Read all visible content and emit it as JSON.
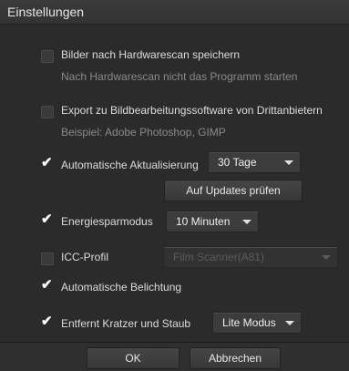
{
  "window": {
    "title": "Einstellungen"
  },
  "settings": {
    "save_hw": {
      "label": "Bilder nach Hardwarescan speichern",
      "checked": false
    },
    "save_hw_hint": "Nach Hardwarescan nicht das Programm starten",
    "export": {
      "label": "Export zu Bildbearbeitungssoftware von Drittanbietern",
      "checked": false
    },
    "export_hint": "Beispiel: Adobe Photoshop, GIMP",
    "auto_update": {
      "label": "Automatische Aktualisierung",
      "checked": true,
      "interval": "30 Tage"
    },
    "check_updates_label": "Auf Updates prüfen",
    "energy": {
      "label": "Energiesparmodus",
      "checked": true,
      "value": "10 Minuten"
    },
    "icc": {
      "label": "ICC-Profil",
      "checked": false,
      "value": "Film Scanner(A81)"
    },
    "auto_exposure": {
      "label": "Automatische Belichtung",
      "checked": true
    },
    "dust": {
      "label": "Entfernt Kratzer und Staub",
      "checked": true,
      "value": "Lite Modus"
    }
  },
  "footer": {
    "ok_label": "OK",
    "cancel_label": "Abbrechen"
  },
  "icons": {
    "check": "checkmark-icon",
    "dropdown": "chevron-down-icon"
  }
}
